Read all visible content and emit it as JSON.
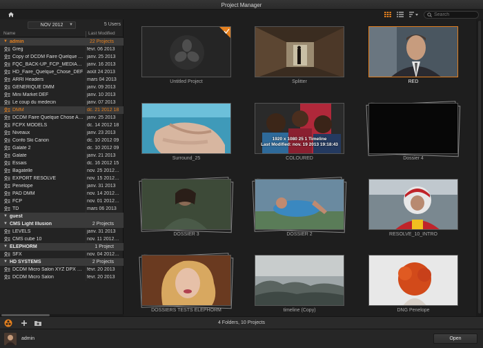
{
  "window": {
    "title": "Project Manager"
  },
  "toolbar": {
    "search_placeholder": "Search"
  },
  "left_panel": {
    "month_filter": "NOV 2012",
    "user_count": "5 Users",
    "columns": {
      "name": "Name",
      "modified": "Last Modified"
    },
    "rows": [
      {
        "kind": "group",
        "name": "admin",
        "count": "22 Projects",
        "active": true
      },
      {
        "kind": "project",
        "name": "Greg",
        "date": "févr. 06 2013"
      },
      {
        "kind": "project",
        "name": "Copy of DCDM Faire Quelque Chose",
        "date": "janv. 25 2013"
      },
      {
        "kind": "project",
        "name": "FQC_BACK-UP_FCP_MEDIASPEED",
        "date": "janv. 16 2013"
      },
      {
        "kind": "project",
        "name": "HD_Faire_Quelque_Chose_DEF",
        "date": "août 24 2013"
      },
      {
        "kind": "project",
        "name": "ARRI Headers",
        "date": "mars 04 2013"
      },
      {
        "kind": "project",
        "name": "GENERIQUE DMM",
        "date": "janv. 09 2013"
      },
      {
        "kind": "project",
        "name": "Mini Market DEF",
        "date": "janv. 10 2013"
      },
      {
        "kind": "project",
        "name": "Le coup du medecin",
        "date": "janv. 07 2013"
      },
      {
        "kind": "project",
        "name": "DMM",
        "date": "dc. 21 2012 18",
        "selected": true
      },
      {
        "kind": "project",
        "name": "DCDM Faire Quelque Chose Archive",
        "date": "janv. 25 2013"
      },
      {
        "kind": "project",
        "name": "FCPX MODELS",
        "date": "dc. 14 2012 18"
      },
      {
        "kind": "project",
        "name": "Niveaux",
        "date": "janv. 23 2013"
      },
      {
        "kind": "project",
        "name": "Confo Ski Canon",
        "date": "dc. 10 2012 09"
      },
      {
        "kind": "project",
        "name": "Galate 2",
        "date": "dc. 10 2012 09"
      },
      {
        "kind": "project",
        "name": "Galate",
        "date": "janv. 21 2013"
      },
      {
        "kind": "project",
        "name": "Essais",
        "date": "dc. 16 2012 15"
      },
      {
        "kind": "project",
        "name": "Bagatelle",
        "date": "nov. 25 2012 22"
      },
      {
        "kind": "project",
        "name": "EXPORT RESOLVE",
        "date": "nov. 15 2012 22"
      },
      {
        "kind": "project",
        "name": "Penelope",
        "date": "janv. 31 2013"
      },
      {
        "kind": "project",
        "name": "PAD DMM",
        "date": "nov. 14 2012 08"
      },
      {
        "kind": "project",
        "name": "FCP",
        "date": "nov. 01 2012 18"
      },
      {
        "kind": "project",
        "name": "TD",
        "date": "mars 06 2013"
      },
      {
        "kind": "group",
        "name": "guest",
        "count": ""
      },
      {
        "kind": "group",
        "name": "CMS Light Illusion",
        "count": "2 Projects"
      },
      {
        "kind": "project",
        "name": "LEVELS",
        "date": "janv. 31 2013"
      },
      {
        "kind": "project",
        "name": "CMS cube  10",
        "date": "nov. 11 2012 23"
      },
      {
        "kind": "group",
        "name": "ELEPHORM",
        "count": "1 Project"
      },
      {
        "kind": "project",
        "name": "SFX",
        "date": "nov. 04 2012 13"
      },
      {
        "kind": "group",
        "name": "HD SYSTEMS",
        "count": "2 Projects"
      },
      {
        "kind": "project",
        "name": "DCDM Micro Salon XYZ DPX 12bits",
        "date": "févr. 20 2013"
      },
      {
        "kind": "project",
        "name": "DCDM Micro Salon",
        "date": "févr. 20 2013"
      }
    ]
  },
  "tiles": [
    {
      "label": "Untitled Project",
      "thumb": "logo",
      "col": 0,
      "row": 0
    },
    {
      "label": "Splitter",
      "thumb": "corridor",
      "col": 1,
      "row": 0
    },
    {
      "label": "RED",
      "thumb": "man",
      "col": 2,
      "row": 0,
      "selected": true
    },
    {
      "label": "Surround_25",
      "thumb": "hands",
      "col": 0,
      "row": 1
    },
    {
      "label": "COLOURED",
      "thumb": "kids",
      "col": 1,
      "row": 1,
      "overlay": [
        "1920 x 1080 25 1 Timeline",
        "Last Modified: nov. 19 2013 19:18:43"
      ]
    },
    {
      "label": "Dossier 4",
      "thumb": "folder-black",
      "col": 2,
      "row": 1
    },
    {
      "label": "DOSSIER 3",
      "thumb": "folder-woman",
      "col": 0,
      "row": 2
    },
    {
      "label": "DOSSIER 2",
      "thumb": "folder-lying",
      "col": 1,
      "row": 2
    },
    {
      "label": "RESOLVE_10_INTRO",
      "thumb": "driver",
      "col": 2,
      "row": 2
    },
    {
      "label": "DOSSIERS TESTS ELEPHORM",
      "thumb": "folder-blonde",
      "col": 0,
      "row": 3
    },
    {
      "label": "timeline (Copy)",
      "thumb": "fog",
      "col": 1,
      "row": 3
    },
    {
      "label": "DNG Penelope",
      "thumb": "redhair",
      "col": 2,
      "row": 3
    }
  ],
  "status": {
    "summary": "4 Folders, 10 Projects"
  },
  "footer": {
    "user": "admin",
    "open_label": "Open"
  },
  "colors": {
    "accent": "#e4801f",
    "background": "#1e1e1e"
  }
}
